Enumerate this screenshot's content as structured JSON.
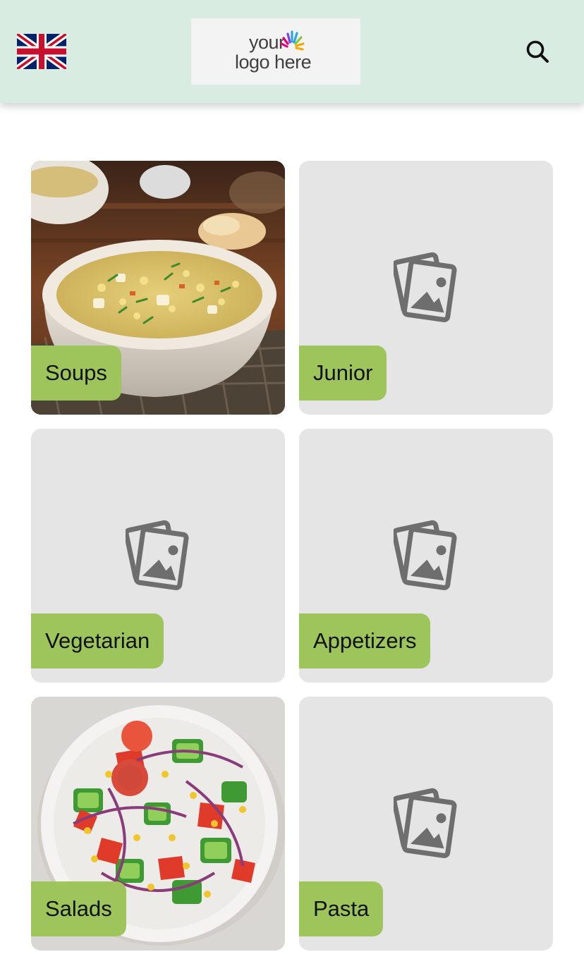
{
  "header": {
    "language_icon": "uk-flag-icon",
    "logo": {
      "line1": "your",
      "line2": "logo here"
    },
    "search_icon": "search-icon"
  },
  "categories": [
    {
      "label": "Soups",
      "image": "soup-photo"
    },
    {
      "label": "Junior",
      "image": "image-placeholder-icon"
    },
    {
      "label": "Vegetarian",
      "image": "image-placeholder-icon"
    },
    {
      "label": "Appetizers",
      "image": "image-placeholder-icon"
    },
    {
      "label": "Salads",
      "image": "salad-photo"
    },
    {
      "label": "Pasta",
      "image": "image-placeholder-icon"
    }
  ],
  "colors": {
    "header_bg": "#d8ece2",
    "label_bg": "#9dc55c",
    "tile_bg": "#e5e5e5",
    "icon_gray": "#6e6e6e"
  }
}
